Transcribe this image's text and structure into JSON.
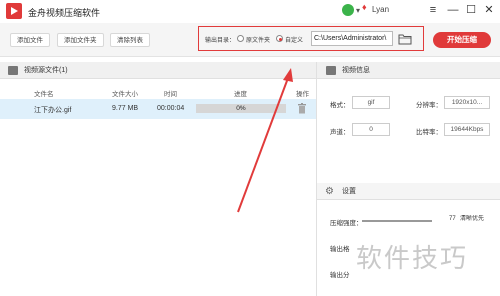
{
  "app": {
    "title": "金舟视频压缩软件",
    "user": "Lyan"
  },
  "toolbar": {
    "add_file": "添加文件",
    "add_folder": "添加文件夹",
    "clear_list": "清除列表",
    "output_label": "输出目录：",
    "radio_source": "原文件夹",
    "radio_custom": "自定义",
    "output_path": "C:\\Users\\Administrator\\",
    "start_button": "开始压缩"
  },
  "file_list": {
    "title": "视频源文件(1)",
    "columns": [
      "文件名",
      "文件大小",
      "时间",
      "进度",
      "操作"
    ],
    "rows": [
      {
        "name": "江下办公.gif",
        "size": "9.77 MB",
        "time": "00:00:04",
        "progress_text": "0%",
        "progress": 0
      }
    ]
  },
  "video_info": {
    "title": "视频信息",
    "format_label": "格式：",
    "format_value": "gif",
    "resolution_label": "分辨率：",
    "resolution_value": "1920x10...",
    "channel_label": "声道：",
    "channel_value": "0",
    "bitrate_label": "比特率：",
    "bitrate_value": "19644Kbps"
  },
  "settings": {
    "title": "设置",
    "compress_label": "压缩强度：",
    "compress_value": "77",
    "compress_hint": "清晰优先",
    "output_format_label": "输出格",
    "output_res_label": "输出分"
  },
  "watermark": "软件技巧",
  "colors": {
    "accent": "#e03a3a",
    "annotation": "#e13b3b",
    "row_highlight": "#dff0fb"
  }
}
